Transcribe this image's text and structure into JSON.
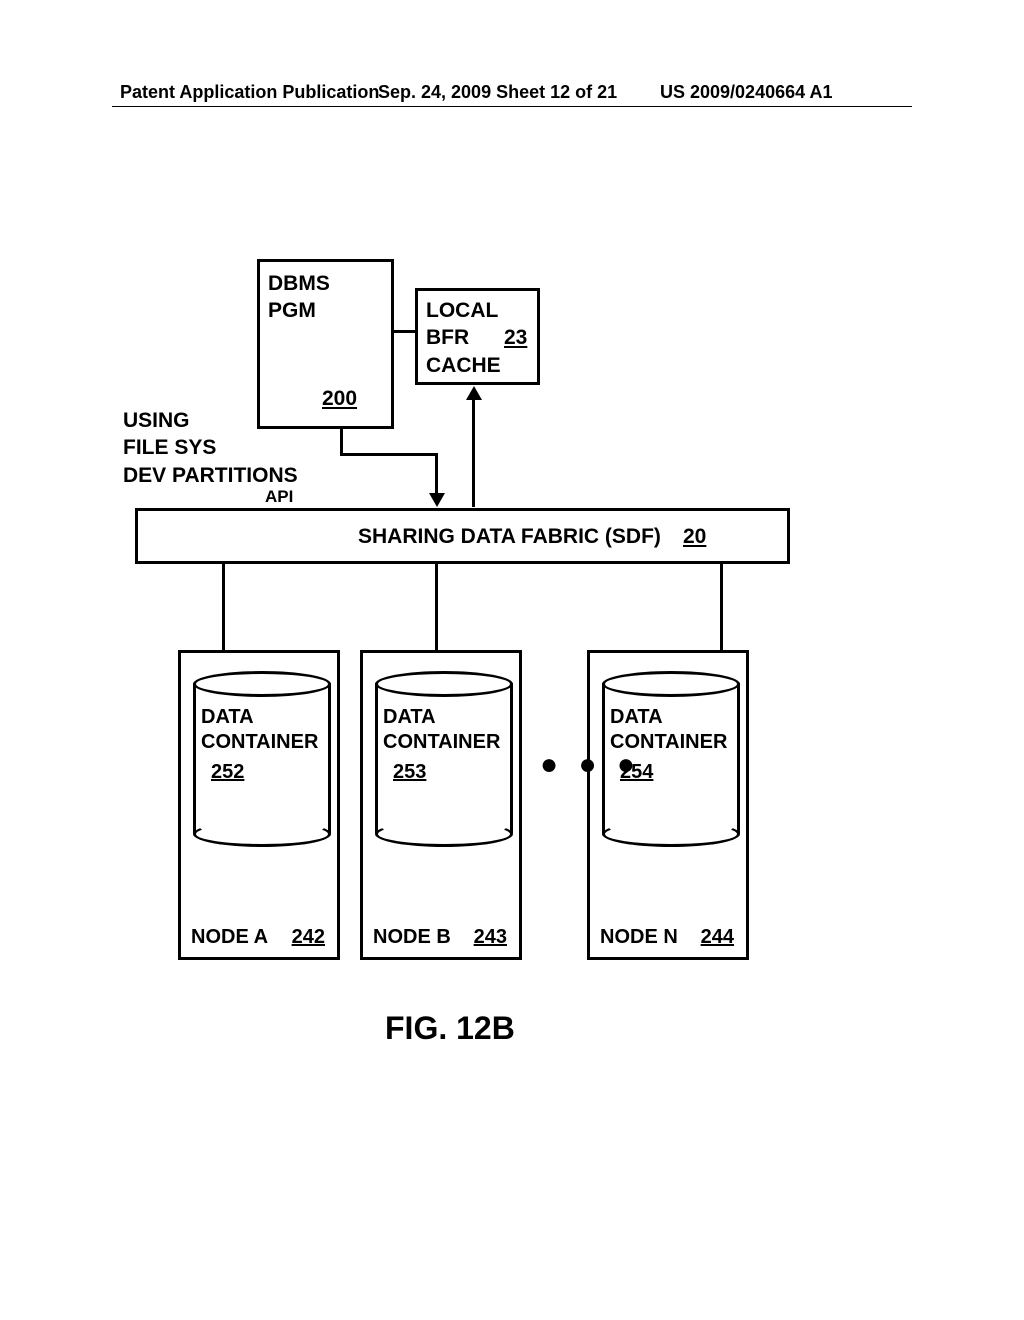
{
  "header": {
    "left": "Patent Application Publication",
    "mid": "Sep. 24, 2009  Sheet 12 of 21",
    "right": "US 2009/0240664 A1"
  },
  "dbms": {
    "line1": "DBMS",
    "line2": "PGM",
    "ref": "200"
  },
  "cache": {
    "line1": "LOCAL",
    "line2": "BFR",
    "line3": "CACHE",
    "ref": "23"
  },
  "sideLabel": {
    "line1": "USING",
    "line2": "FILE SYS",
    "line3": "DEV PARTITIONS"
  },
  "api": "API",
  "sdf": {
    "text": "SHARING DATA FABRIC (SDF)",
    "ref": "20"
  },
  "nodes": {
    "a": {
      "label": "NODE A",
      "ref": "242",
      "container": "DATA\nCONTAINER",
      "cref": "252"
    },
    "b": {
      "label": "NODE B",
      "ref": "243",
      "container": "DATA\nCONTAINER",
      "cref": "253"
    },
    "n": {
      "label": "NODE N",
      "ref": "244",
      "container": "DATA\nCONTAINER",
      "cref": "254"
    }
  },
  "ellipsis": "● ● ●",
  "figLabel": "FIG. 12B"
}
